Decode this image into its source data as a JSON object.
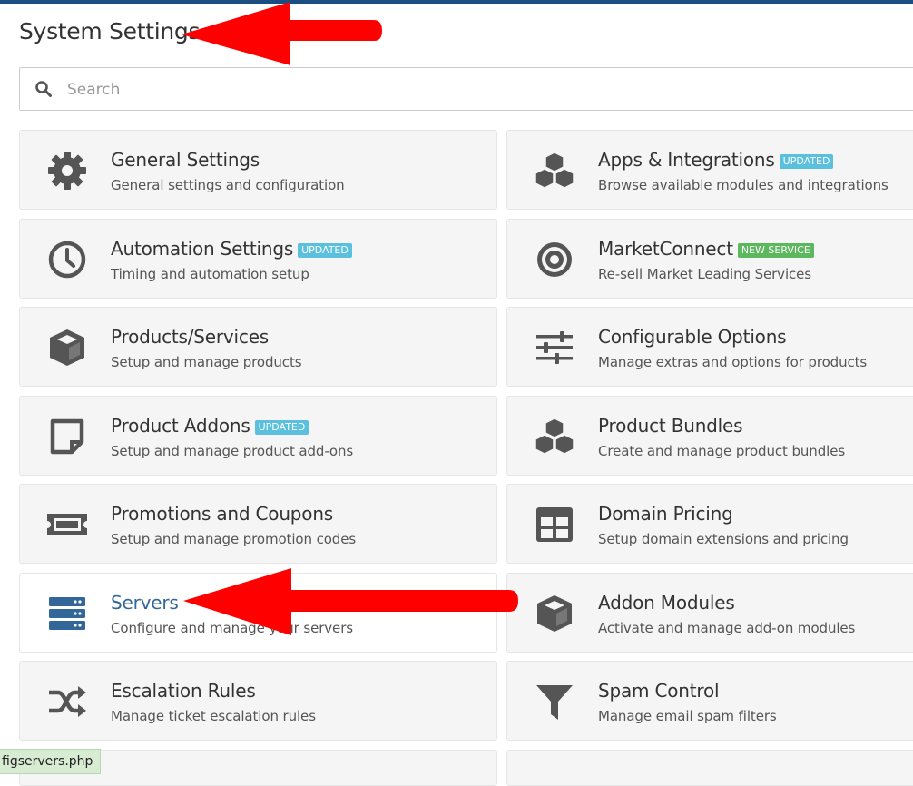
{
  "page": {
    "title": "System Settings"
  },
  "search": {
    "placeholder": "Search",
    "value": ""
  },
  "tiles": [
    {
      "title": "General Settings",
      "desc": "General settings and configuration",
      "badge": "",
      "icon": "gear-icon"
    },
    {
      "title": "Apps & Integrations",
      "desc": "Browse available modules and integrations",
      "badge": "UPDATED",
      "icon": "cubes-icon"
    },
    {
      "title": "Automation Settings",
      "desc": "Timing and automation setup",
      "badge": "UPDATED",
      "icon": "clock-icon"
    },
    {
      "title": "MarketConnect",
      "desc": "Re-sell Market Leading Services",
      "badge": "NEW SERVICE",
      "icon": "bullseye-icon"
    },
    {
      "title": "Products/Services",
      "desc": "Setup and manage products",
      "badge": "",
      "icon": "cube-icon"
    },
    {
      "title": "Configurable Options",
      "desc": "Manage extras and options for products",
      "badge": "",
      "icon": "sliders-icon"
    },
    {
      "title": "Product Addons",
      "desc": "Setup and manage product add-ons",
      "badge": "UPDATED",
      "icon": "sticky-note-icon"
    },
    {
      "title": "Product Bundles",
      "desc": "Create and manage product bundles",
      "badge": "",
      "icon": "cubes-icon"
    },
    {
      "title": "Promotions and Coupons",
      "desc": "Setup and manage promotion codes",
      "badge": "",
      "icon": "ticket-icon"
    },
    {
      "title": "Domain Pricing",
      "desc": "Setup domain extensions and pricing",
      "badge": "",
      "icon": "grid-icon"
    },
    {
      "title": "Servers",
      "desc": "Configure and manage your servers",
      "badge": "",
      "icon": "server-icon"
    },
    {
      "title": "Addon Modules",
      "desc": "Activate and manage add-on modules",
      "badge": "",
      "icon": "cube-icon"
    },
    {
      "title": "Escalation Rules",
      "desc": "Manage ticket escalation rules",
      "badge": "",
      "icon": "random-icon"
    },
    {
      "title": "Spam Control",
      "desc": "Manage email spam filters",
      "badge": "",
      "icon": "filter-icon"
    }
  ],
  "status_bar": {
    "url": "figservers.php"
  },
  "colors": {
    "accent": "#336699",
    "arrow": "#ff0000",
    "badge_updated": "#5bc0de",
    "badge_new": "#5cb85c",
    "topbar": "#1a4d80"
  }
}
